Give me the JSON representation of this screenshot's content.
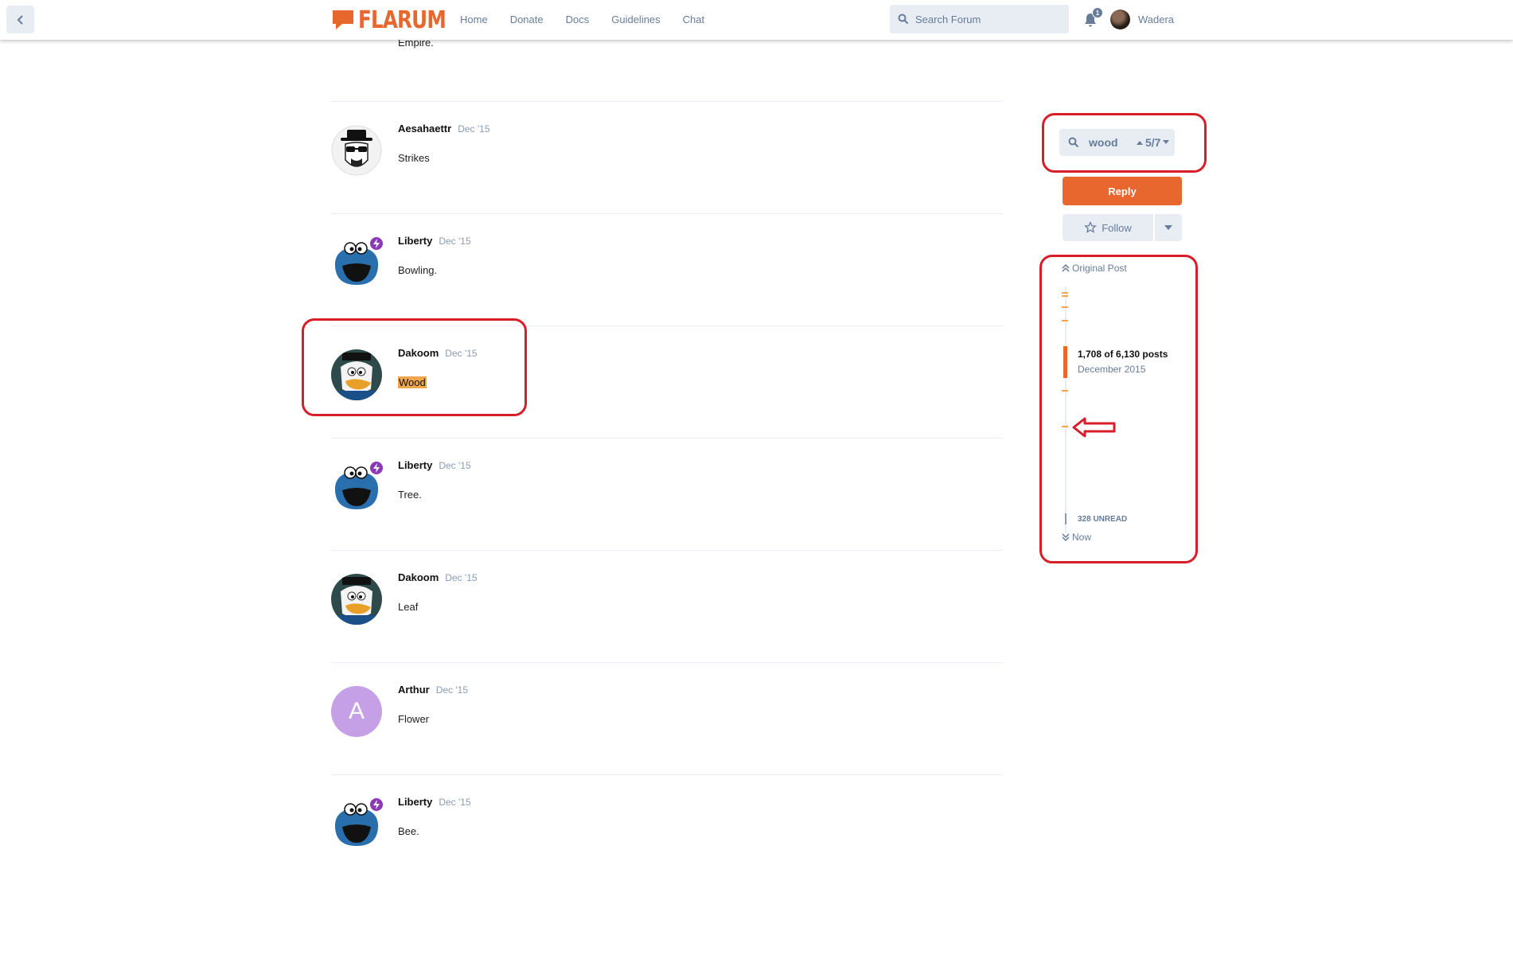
{
  "header": {
    "logo_text": "FLARUM",
    "nav": [
      "Home",
      "Donate",
      "Docs",
      "Guidelines",
      "Chat"
    ],
    "search_placeholder": "Search Forum",
    "notification_count": "1",
    "username": "Wadera"
  },
  "partial_post": {
    "body": "Empire."
  },
  "posts": [
    {
      "author": "Aesahaettr",
      "date": "Dec '15",
      "body": "Strikes",
      "avatar": "heisenberg-avatar"
    },
    {
      "author": "Liberty",
      "date": "Dec '15",
      "body": "Bowling.",
      "avatar": "cookie-monster-avatar"
    },
    {
      "author": "Dakoom",
      "date": "Dec '15",
      "body": "Wood",
      "avatar": "scrooge-avatar",
      "highlighted": true
    },
    {
      "author": "Liberty",
      "date": "Dec '15",
      "body": "Tree.",
      "avatar": "cookie-monster-avatar"
    },
    {
      "author": "Dakoom",
      "date": "Dec '15",
      "body": "Leaf",
      "avatar": "scrooge-avatar"
    },
    {
      "author": "Arthur",
      "date": "Dec '15",
      "body": "Flower",
      "avatar": "letter-avatar",
      "avatar_letter": "A"
    },
    {
      "author": "Liberty",
      "date": "Dec '15",
      "body": "Bee.",
      "avatar": "cookie-monster-avatar"
    }
  ],
  "sidebar": {
    "search_term": "wood",
    "search_position": "5/7",
    "reply_label": "Reply",
    "follow_label": "Follow",
    "scrubber": {
      "original_post_label": "Original Post",
      "position_text": "1,708 of 6,130 posts",
      "date_text": "December 2015",
      "unread_label": "328 UNREAD",
      "now_label": "Now"
    }
  },
  "colors": {
    "brand": "#e7672e",
    "muted": "#667c99",
    "highlight": "#f0a64a",
    "annotation": "#d81e28",
    "badge": "#8c39b9"
  }
}
